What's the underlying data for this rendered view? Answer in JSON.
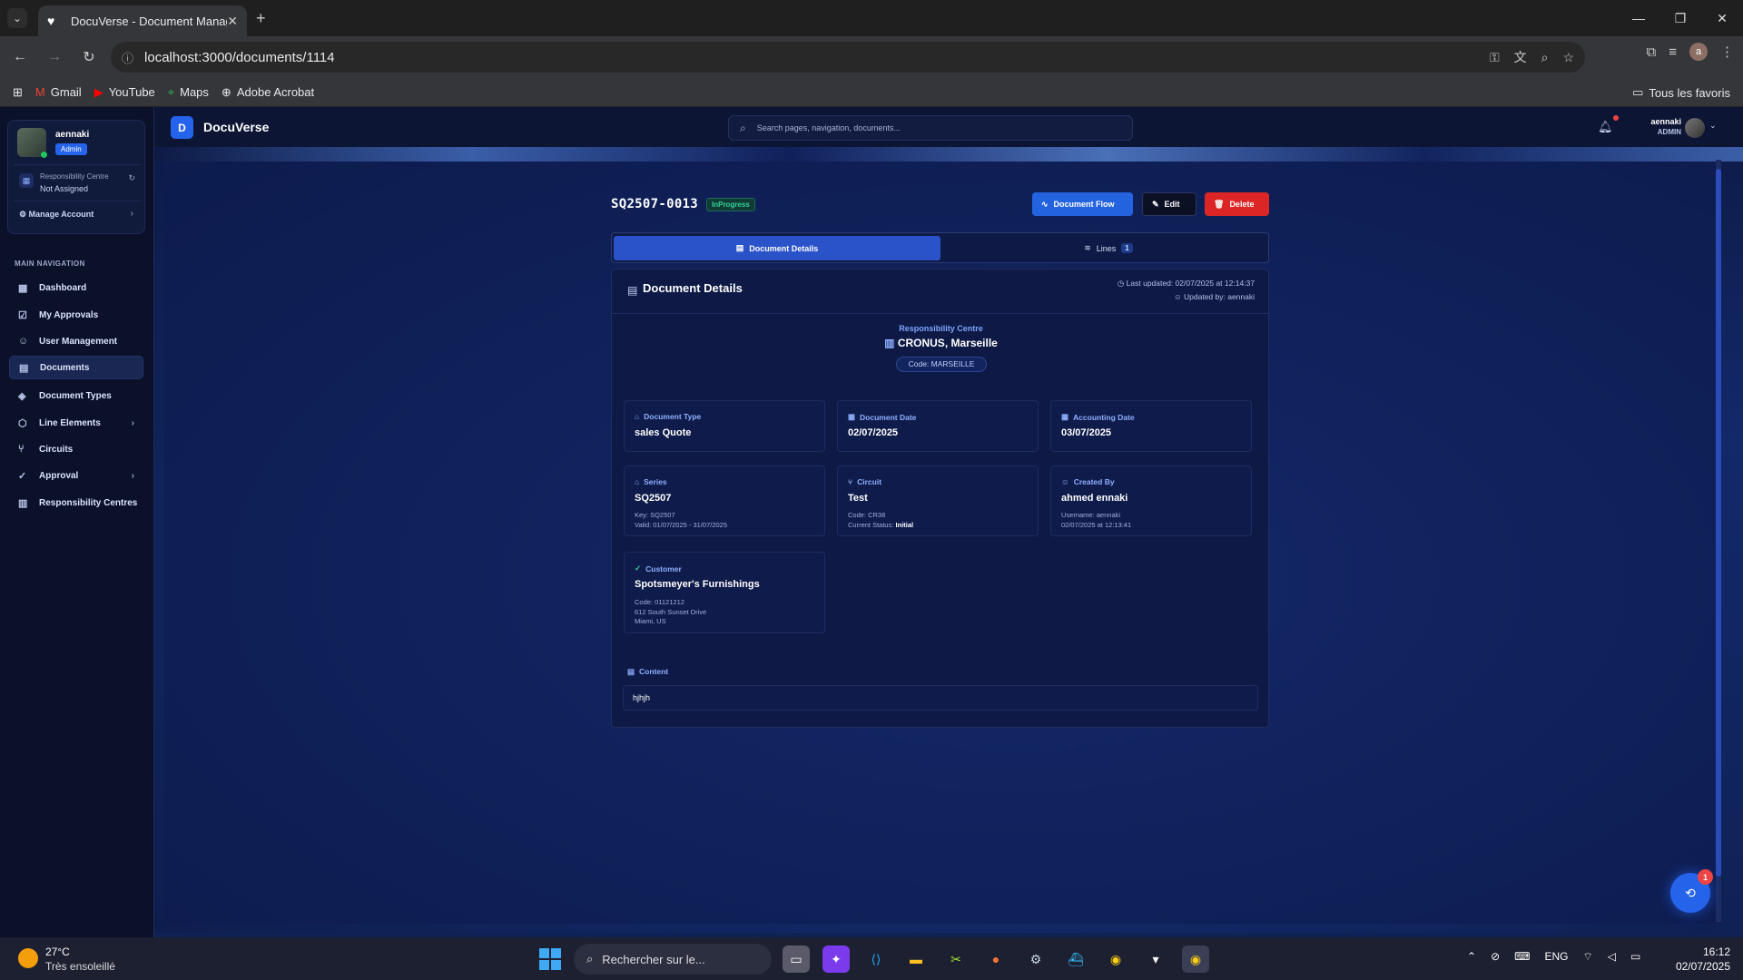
{
  "browser": {
    "tab_title": "DocuVerse - Document Manag",
    "url": "localhost:3000/documents/1114",
    "bookmarks": [
      "Gmail",
      "YouTube",
      "Maps",
      "Adobe Acrobat"
    ],
    "all_bookmarks": "Tous les favoris",
    "profile_initial": "a"
  },
  "sidebar": {
    "user": {
      "name": "aennaki",
      "role": "Admin"
    },
    "responsibility_centre_label": "Responsibility Centre",
    "responsibility_centre_value": "Not Assigned",
    "manage_account": "Manage Account",
    "nav_heading": "MAIN NAVIGATION",
    "items": [
      {
        "label": "Dashboard",
        "icon": "dashboard-icon"
      },
      {
        "label": "My Approvals",
        "icon": "clipboard-check-icon"
      },
      {
        "label": "User Management",
        "icon": "users-icon"
      },
      {
        "label": "Documents",
        "icon": "document-icon",
        "active": true
      },
      {
        "label": "Document Types",
        "icon": "layers-icon"
      },
      {
        "label": "Line Elements",
        "icon": "box-icon",
        "expandable": true
      },
      {
        "label": "Circuits",
        "icon": "git-branch-icon"
      },
      {
        "label": "Approval",
        "icon": "user-check-icon",
        "expandable": true
      },
      {
        "label": "Responsibility Centres",
        "icon": "building-icon"
      }
    ]
  },
  "topbar": {
    "brand_letter": "D",
    "brand": "DocuVerse",
    "search_placeholder": "Search pages, navigation, documents...",
    "user_name": "aennaki",
    "user_role": "ADMIN"
  },
  "document": {
    "id": "SQ2507-0013",
    "status": "InProgress",
    "actions": {
      "flow": "Document Flow",
      "edit": "Edit",
      "delete": "Delete"
    },
    "tabs": {
      "details": "Document Details",
      "lines": "Lines",
      "lines_count": "1"
    },
    "card_title": "Document Details",
    "last_updated": "Last updated: 02/07/2025 at 12:14:37",
    "updated_by": "Updated by: aennaki",
    "responsibility_centre": {
      "label": "Responsibility Centre",
      "name": "CRONUS, Marseille",
      "code": "Code: MARSEILLE"
    },
    "fields": {
      "document_type": {
        "label": "Document Type",
        "value": "sales Quote"
      },
      "document_date": {
        "label": "Document Date",
        "value": "02/07/2025"
      },
      "accounting_date": {
        "label": "Accounting Date",
        "value": "03/07/2025"
      },
      "series": {
        "label": "Series",
        "value": "SQ2507",
        "key": "Key: SQ2507",
        "valid": "Valid: 01/07/2025 - 31/07/2025"
      },
      "circuit": {
        "label": "Circuit",
        "value": "Test",
        "code": "Code: CR38",
        "status_label": "Current Status:",
        "status_value": "Initial"
      },
      "created_by": {
        "label": "Created By",
        "value": "ahmed ennaki",
        "username": "Username: aennaki",
        "date": "02/07/2025 at 12:13:41"
      },
      "customer": {
        "label": "Customer",
        "value": "Spotsmeyer's Furnishings",
        "code": "Code: 01121212",
        "address": "612 South Sunset Drive",
        "city": "Miami, US"
      }
    },
    "content_label": "Content",
    "content_value": "hjhjh"
  },
  "fab_badge": "1",
  "taskbar": {
    "temp": "27°C",
    "weather": "Très ensoleillé",
    "search": "Rechercher sur le...",
    "lang": "ENG",
    "time": "16:12",
    "date": "02/07/2025"
  }
}
